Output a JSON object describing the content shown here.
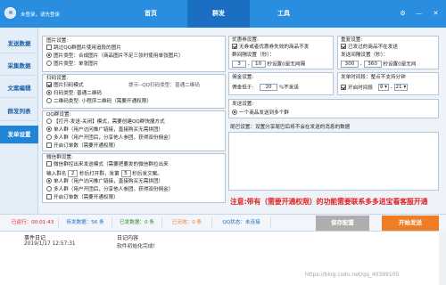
{
  "titlebar": {
    "user_text": "未登录，请先登录",
    "tabs": [
      "首页",
      "群发",
      "工具"
    ]
  },
  "sidebar": {
    "items": [
      "发送数据",
      "采集数据",
      "文案编辑",
      "群发列表",
      "发单设置"
    ]
  },
  "colors": {
    "primary": "#2a8ee0",
    "warning_red": "#e02020",
    "save_button": "#aeaeae",
    "start_button": "#f07c24"
  },
  "image": {
    "title": "图片设置:",
    "skip": "跳过QQ群图片使用追段的图片",
    "opt1": "图片类型：合成图片（商品图片不足三张时使用单张图片）",
    "opt2": "图片类型：单张图片"
  },
  "qr": {
    "title": "扫码设置:",
    "enable": "图片扫码模式",
    "hint": "提示--QQ扫码类型：普通二维码",
    "type_label": "扫码类型:",
    "type_value": "普通二维码",
    "small_label": "二维码类型:",
    "small_value": "小程序二维码（需要开通权限）"
  },
  "qqgroup": {
    "title": "QQ群设置:",
    "mode": "【打开-发送-关闭】模式，需要创建QQ群快捷方式",
    "single": "单人群（用户访问推广链接，直接购买无需拼团）",
    "multi": "多人群（用户开团后，分享他人参团，获得双份佣金）",
    "open_order": "开启订单数（需要开通权限）"
  },
  "wechat": {
    "title": "微信群设置:",
    "mode": "微信群控出来发送模式（需要把要发的微信群拉出来",
    "input_label": "输入群名",
    "input_value": "2",
    "sec_label": "秒后打开群，发第",
    "sec_value": "5",
    "tail": "秒后发文案。",
    "single": "单人群（用户访问推广链接，直接购买无需拼团）",
    "multi": "多人群（用户开团后，分享他人参团，获得双份佣金）",
    "open_order": "开启订单数（需要开通权限）"
  },
  "coupon": {
    "title": "优惠券设置:",
    "item1": "无券或者优惠券失效的商品不发",
    "interval_title": "群间隔设置（秒）：",
    "interval_from": "3",
    "interval_to": "10",
    "interval_tail": "秒设置0是无间隔"
  },
  "repeat": {
    "title": "重复设置:",
    "item": "已发过的商品不在发送",
    "send_interval_title": "发送间隔设置（秒）：",
    "from": "300",
    "to": "360",
    "tail": "秒设置0是无间"
  },
  "commission": {
    "title": "佣金设置:",
    "label": "佣金低于:",
    "value": "20",
    "tail": "%不发送"
  },
  "sendtime": {
    "title": "发单时间段：整点不支持分钟",
    "enable": "开启时间段",
    "from": "9",
    "to": "21"
  },
  "sendset": {
    "title": "发送设置:",
    "option": "一个商品发送到多个群"
  },
  "tail_set": {
    "title": "尾巴设置：设置分享尾巴后将不会在发送的消息的数据"
  },
  "notice": "注意:带有（需要开通权限）的功能需要联系多多进宝看客服开通",
  "status": {
    "sent": "已运行：00:01:43",
    "pending": "待发数据：56 条",
    "done": "已发数据：0 条",
    "invalid": "已无效：0 条",
    "qq": "QQ状态：未连接",
    "save": "保存配置",
    "start": "开始发送"
  },
  "log": {
    "col_time": "事件日记",
    "col_content": "日记内容",
    "time": "2019/1/17 12:57:31",
    "content": "软件初始化完成!"
  },
  "watermark": "https://blog.csdn.net/qq_40399105"
}
